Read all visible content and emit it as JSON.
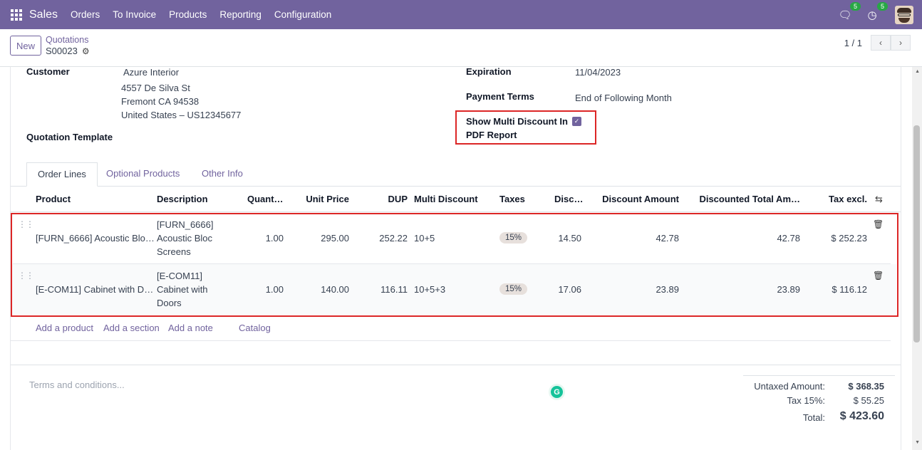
{
  "topbar": {
    "app_name": "Sales",
    "menu": [
      "Orders",
      "To Invoice",
      "Products",
      "Reporting",
      "Configuration"
    ],
    "messages_badge": "5",
    "activities_badge": "5",
    "icons": [
      "apps-icon",
      "chat-icon",
      "clock-icon",
      "avatar"
    ],
    "color": "#71639e"
  },
  "control": {
    "new_label": "New",
    "breadcrumb": "Quotations",
    "record_name": "S00023",
    "pager": "1 / 1",
    "prev": "‹",
    "next": "›"
  },
  "form": {
    "customer_label": "Customer",
    "customer_name": "Azure Interior",
    "address_line1": "4557 De Silva St",
    "address_line2": "Fremont CA 94538",
    "address_line3": "United States – US12345677",
    "template_label": "Quotation Template",
    "expiration_label": "Expiration",
    "expiration_value": "11/04/2023",
    "payment_terms_label": "Payment Terms",
    "payment_terms_value": "End of Following Month",
    "multi_discount_label_1": "Show Multi Discount In",
    "multi_discount_label_2": "PDF Report",
    "multi_discount_checked": true
  },
  "tabs": [
    "Order Lines",
    "Optional Products",
    "Other Info"
  ],
  "table": {
    "headers": {
      "product": "Product",
      "description": "Description",
      "quantity": "Quant…",
      "unit_price": "Unit Price",
      "dup": "DUP",
      "multi_discount": "Multi Discount",
      "taxes": "Taxes",
      "disc": "Disc…",
      "discount_amount": "Discount Amount",
      "discounted_total": "Discounted Total Am…",
      "tax_excl": "Tax excl."
    },
    "rows": [
      {
        "product": "[FURN_6666] Acoustic Blo…",
        "desc1": "[FURN_6666]",
        "desc2": "Acoustic Bloc",
        "desc3": "Screens",
        "quantity": "1.00",
        "unit_price": "295.00",
        "dup": "252.22",
        "multi_discount": "10+5",
        "taxes": "15%",
        "disc": "14.50",
        "discount_amount": "42.78",
        "discounted_total": "42.78",
        "tax_excl": "$ 252.23"
      },
      {
        "product": "[E-COM11] Cabinet with D…",
        "desc1": "[E-COM11]",
        "desc2": "Cabinet with",
        "desc3": "Doors",
        "quantity": "1.00",
        "unit_price": "140.00",
        "dup": "116.11",
        "multi_discount": "10+5+3",
        "taxes": "15%",
        "disc": "17.06",
        "discount_amount": "23.89",
        "discounted_total": "23.89",
        "tax_excl": "$ 116.12"
      }
    ],
    "add_product": "Add a product",
    "add_section": "Add a section",
    "add_note": "Add a note",
    "catalog": "Catalog"
  },
  "footer": {
    "terms_placeholder": "Terms and conditions...",
    "untaxed_label": "Untaxed Amount:",
    "untaxed_value": "$ 368.35",
    "tax_label": "Tax 15%:",
    "tax_value": "$ 55.25",
    "total_label": "Total:",
    "total_value": "$ 423.60"
  }
}
